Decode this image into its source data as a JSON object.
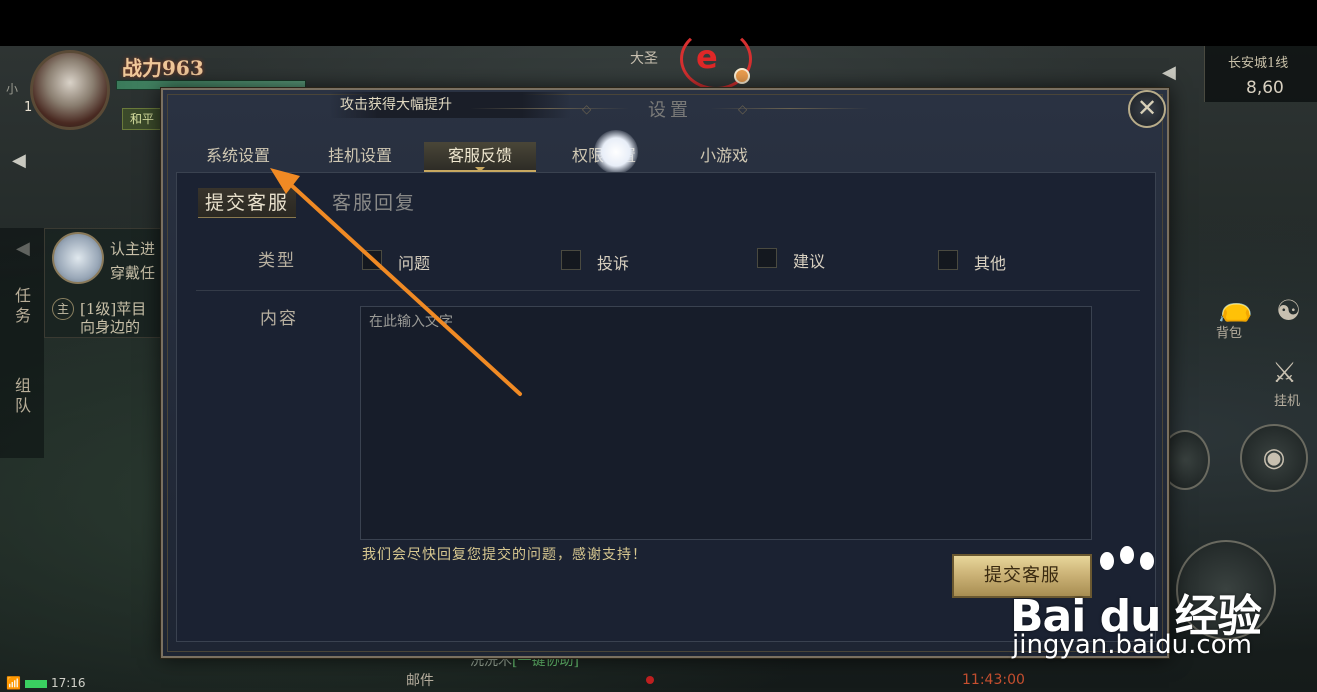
{
  "hud": {
    "power": "战力963",
    "level": "1",
    "left_small": "小",
    "mode": "和平",
    "center_top": "大圣",
    "city": "长安城1线",
    "coords": "8,60",
    "bag_label": "背包",
    "auto_label": "挂机",
    "mail_label": "邮件",
    "chat_prefix": "洗洗木",
    "chat_link": "[一键协助]",
    "game_time": "11:43:00",
    "clock": "17:16",
    "quest_tab": "任务",
    "team_tab": "组队",
    "quest_line1": "认主进",
    "quest_line2": "穿戴任",
    "quest_line3": "[1级]苹目",
    "quest_line4": "向身边的",
    "quest_circle": "主"
  },
  "dialog": {
    "title": "设置",
    "buff_banner": "攻击获得大幅提升",
    "close_glyph": "✕",
    "tabs": [
      {
        "label": "系统设置"
      },
      {
        "label": "挂机设置"
      },
      {
        "label": "客服反馈"
      },
      {
        "label": "权限设置"
      },
      {
        "label": "小游戏"
      }
    ],
    "active_tab": "客服反馈",
    "subtabs": {
      "submit": "提交客服",
      "reply": "客服回复"
    },
    "form": {
      "type_label": "类型",
      "content_label": "内容",
      "options": [
        "问题",
        "投诉",
        "建议",
        "其他"
      ],
      "content_placeholder": "在此输入文字",
      "hint": "我们会尽快回复您提交的问题，感谢支持！",
      "submit_label": "提交客服"
    }
  },
  "watermark": {
    "brand": "Bai du 经验",
    "url": "jingyan.baidu.com"
  },
  "colors": {
    "annotation_arrow": "#f08a24",
    "accent_gold": "#c8a860",
    "submit_gold": "#c9b074"
  },
  "icons": {
    "close": "close-icon",
    "back_arrow": "chevron-left-icon",
    "bag": "bag-icon",
    "yin_yang": "yin-yang-icon",
    "crossed_swords": "crossed-swords-icon"
  }
}
